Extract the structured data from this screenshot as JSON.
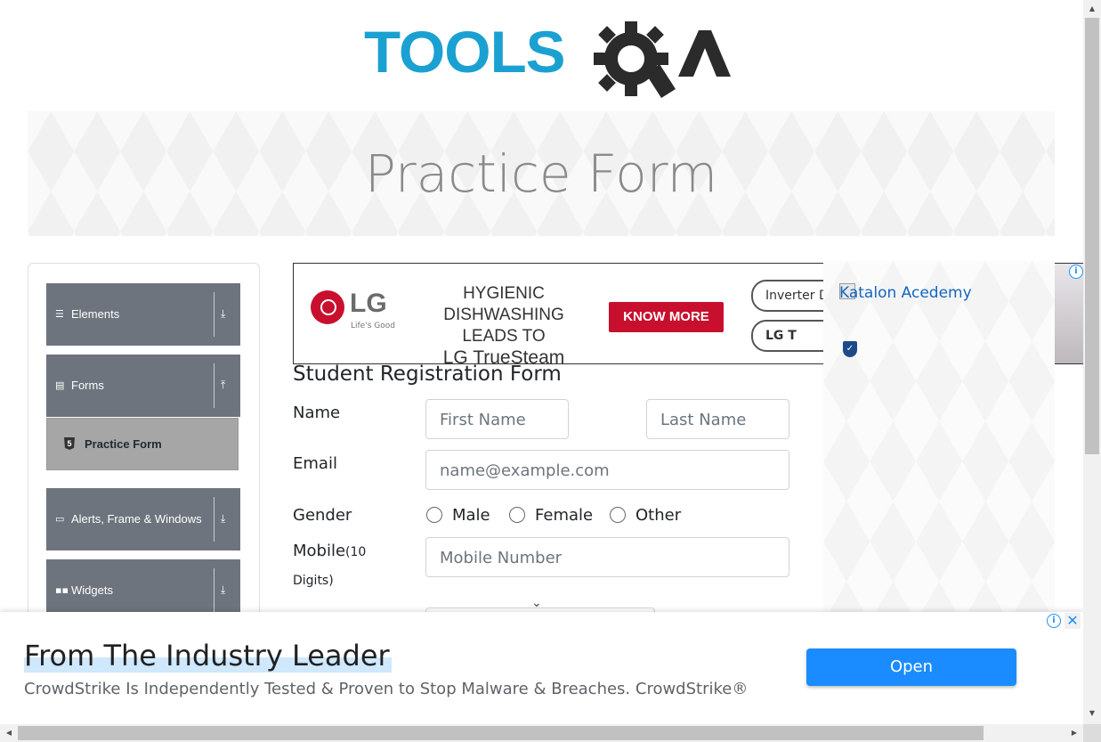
{
  "logo": {
    "text_left": "TOOLS",
    "text_right": "QA"
  },
  "banner": {
    "title": "Practice Form"
  },
  "sidebar": {
    "groups": [
      {
        "label": "Elements",
        "icon": "menu-icon",
        "arrow": "⤓"
      },
      {
        "label": "Forms",
        "icon": "form-icon",
        "arrow": "⤒"
      },
      {
        "label": "Alerts, Frame & Windows",
        "icon": "window-icon",
        "arrow": "⤓"
      },
      {
        "label": "Widgets",
        "icon": "widgets-icon",
        "arrow": "⤓"
      }
    ],
    "active_item": {
      "label": "Practice Form",
      "icon": "html5-icon"
    }
  },
  "lg_ad": {
    "brand": "LG",
    "tagline": "Life's Good",
    "headline_1": "HYGIENIC DISHWASHING",
    "headline_2": "LEADS TO",
    "headline_3": "LG TrueSteam",
    "cta": "KNOW MORE",
    "pill_1": "Inverter D",
    "pill_2": "LG T",
    "accent": "#c8102e"
  },
  "side_ad": {
    "alt_text": "Katalon Acedemy"
  },
  "form": {
    "title": "Student Registration Form",
    "name_label": "Name",
    "first_name_placeholder": "First Name",
    "last_name_placeholder": "Last Name",
    "email_label": "Email",
    "email_placeholder": "name@example.com",
    "gender_label": "Gender",
    "gender_options": [
      "Male",
      "Female",
      "Other"
    ],
    "mobile_label": "Mobile",
    "mobile_hint": "(10",
    "mobile_hint_2": "Digits)",
    "mobile_placeholder": "Mobile Number"
  },
  "bottom_ad": {
    "title": "From The Industry Leader",
    "description": "CrowdStrike Is Independently Tested & Proven to Stop Malware & Breaches. CrowdStrike®",
    "open_label": "Open",
    "accent": "#1a8cff"
  }
}
